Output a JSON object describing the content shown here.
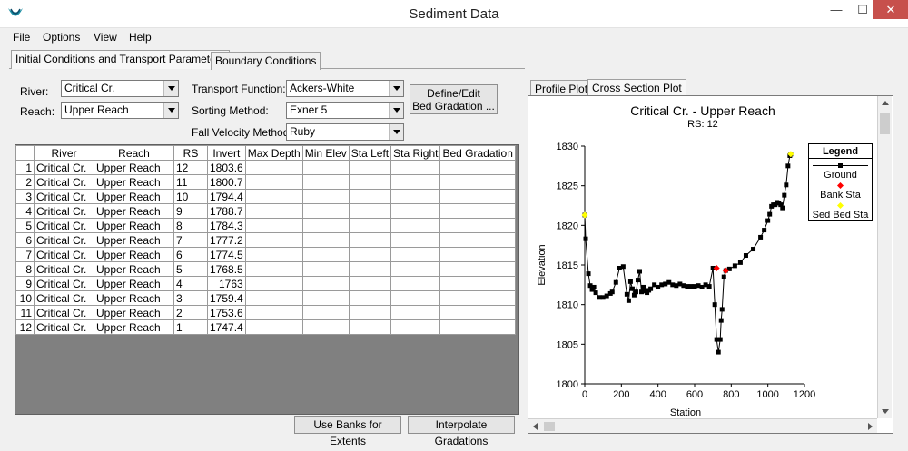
{
  "window": {
    "title": "Sediment Data",
    "min": "—",
    "max": "☐",
    "close": "✕"
  },
  "menu": [
    "File",
    "Options",
    "View",
    "Help"
  ],
  "tabs": [
    "Initial Conditions and Transport Parameters",
    "Boundary Conditions"
  ],
  "form": {
    "river_label": "River:",
    "river_value": "Critical Cr.",
    "reach_label": "Reach:",
    "reach_value": "Upper Reach",
    "transport_label": "Transport Function:",
    "transport_value": "Ackers-White",
    "sorting_label": "Sorting Method:",
    "sorting_value": "Exner 5",
    "fall_label": "Fall Velocity Method:",
    "fall_value": "Ruby",
    "define_button": "Define/Edit\nBed Gradation ..."
  },
  "table": {
    "headers": [
      "",
      "River",
      "Reach",
      "RS",
      "Invert",
      "Max Depth",
      "Min Elev",
      "Sta Left",
      "Sta Right",
      "Bed Gradation"
    ],
    "rows": [
      [
        "1",
        "Critical Cr.",
        "Upper Reach",
        "12",
        "1803.6"
      ],
      [
        "2",
        "Critical Cr.",
        "Upper Reach",
        "11",
        "1800.7"
      ],
      [
        "3",
        "Critical Cr.",
        "Upper Reach",
        "10",
        "1794.4"
      ],
      [
        "4",
        "Critical Cr.",
        "Upper Reach",
        "9",
        "1788.7"
      ],
      [
        "5",
        "Critical Cr.",
        "Upper Reach",
        "8",
        "1784.3"
      ],
      [
        "6",
        "Critical Cr.",
        "Upper Reach",
        "7",
        "1777.2"
      ],
      [
        "7",
        "Critical Cr.",
        "Upper Reach",
        "6",
        "1774.5"
      ],
      [
        "8",
        "Critical Cr.",
        "Upper Reach",
        "5",
        "1768.5"
      ],
      [
        "9",
        "Critical Cr.",
        "Upper Reach",
        "4",
        "1763"
      ],
      [
        "10",
        "Critical Cr.",
        "Upper Reach",
        "3",
        "1759.4"
      ],
      [
        "11",
        "Critical Cr.",
        "Upper Reach",
        "2",
        "1753.6"
      ],
      [
        "12",
        "Critical Cr.",
        "Upper Reach",
        "1",
        "1747.4"
      ]
    ]
  },
  "buttons": {
    "use_banks": "Use Banks for Extents",
    "interpolate": "Interpolate Gradations"
  },
  "plot_tabs": [
    "Profile Plot",
    "Cross Section Plot"
  ],
  "plot": {
    "title": "Critical Cr.       - Upper Reach",
    "subtitle": "RS: 12",
    "legend_title": "Legend",
    "legend_items": [
      "Ground",
      "Bank Sta",
      "Sed Bed Sta"
    ]
  },
  "chart_data": {
    "type": "line",
    "xlabel": "Station",
    "ylabel": "Elevation",
    "xlim": [
      0,
      1200
    ],
    "ylim": [
      1800,
      1830
    ],
    "xticks": [
      0,
      200,
      400,
      600,
      800,
      1000,
      1200
    ],
    "yticks": [
      1800,
      1805,
      1810,
      1815,
      1820,
      1825,
      1830
    ],
    "colors": {
      "ground": "#000000",
      "bank": "#ff0000",
      "sed": "#ffff00"
    },
    "series": [
      {
        "name": "Ground",
        "x": [
          0,
          5,
          20,
          30,
          40,
          50,
          60,
          80,
          100,
          120,
          140,
          150,
          170,
          190,
          210,
          230,
          240,
          250,
          260,
          270,
          280,
          290,
          300,
          310,
          320,
          330,
          340,
          350,
          360,
          380,
          400,
          420,
          440,
          460,
          480,
          500,
          520,
          540,
          560,
          580,
          600,
          620,
          640,
          660,
          680,
          700,
          710,
          720,
          730,
          740,
          745,
          750,
          760,
          770,
          790,
          820,
          850,
          880,
          920,
          960,
          980,
          1000,
          1010,
          1020,
          1030,
          1040,
          1050,
          1060,
          1070,
          1080,
          1090,
          1100,
          1110,
          1120,
          1125
        ],
        "y": [
          1821.3,
          1818.3,
          1813.9,
          1812.4,
          1811.9,
          1812.2,
          1811.5,
          1810.9,
          1810.9,
          1811.1,
          1811.4,
          1811.6,
          1812.8,
          1814.6,
          1814.8,
          1811.3,
          1810.5,
          1812.9,
          1812.0,
          1811.2,
          1811.6,
          1813.1,
          1814.2,
          1811.6,
          1812.2,
          1811.7,
          1811.5,
          1811.8,
          1812.0,
          1812.5,
          1812.2,
          1812.5,
          1812.6,
          1812.8,
          1812.5,
          1812.4,
          1812.6,
          1812.4,
          1812.3,
          1812.3,
          1812.3,
          1812.4,
          1812.2,
          1812.5,
          1812.3,
          1814.6,
          1810.0,
          1805.6,
          1804.0,
          1805.6,
          1808.0,
          1809.4,
          1813.5,
          1814.3,
          1814.5,
          1814.9,
          1815.3,
          1816.2,
          1817.0,
          1818.5,
          1819.4,
          1820.6,
          1821.4,
          1822.4,
          1822.6,
          1822.6,
          1822.9,
          1822.8,
          1822.6,
          1822.2,
          1823.8,
          1825.1,
          1827.5,
          1828.8,
          1829.0
        ]
      },
      {
        "name": "Bank Sta",
        "x": [
          720,
          770
        ],
        "y": [
          1814.6,
          1814.3
        ]
      },
      {
        "name": "Sed Bed Sta",
        "x": [
          0,
          1125
        ],
        "y": [
          1821.3,
          1829.0
        ]
      }
    ]
  }
}
